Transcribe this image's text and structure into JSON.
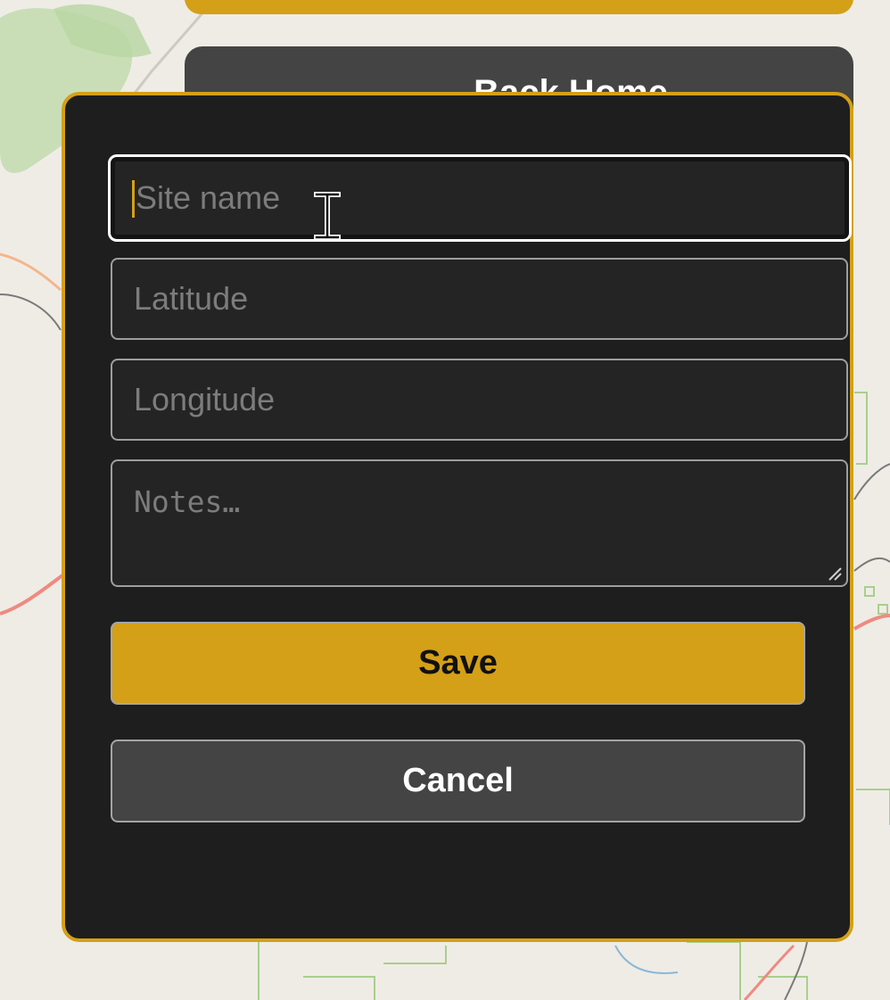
{
  "background": {
    "back_home_label": "Back Home"
  },
  "form": {
    "site_name_placeholder": "Site name",
    "latitude_placeholder": "Latitude",
    "longitude_placeholder": "Longitude",
    "notes_placeholder": "Notes…",
    "save_label": "Save",
    "cancel_label": "Cancel"
  },
  "colors": {
    "accent": "#d4a017",
    "modal_bg": "#1e1e1e",
    "field_bg": "#242424",
    "secondary_button": "#444444"
  },
  "icons": {
    "cursor": "text-cursor-icon",
    "resize": "resize-grip-icon"
  }
}
